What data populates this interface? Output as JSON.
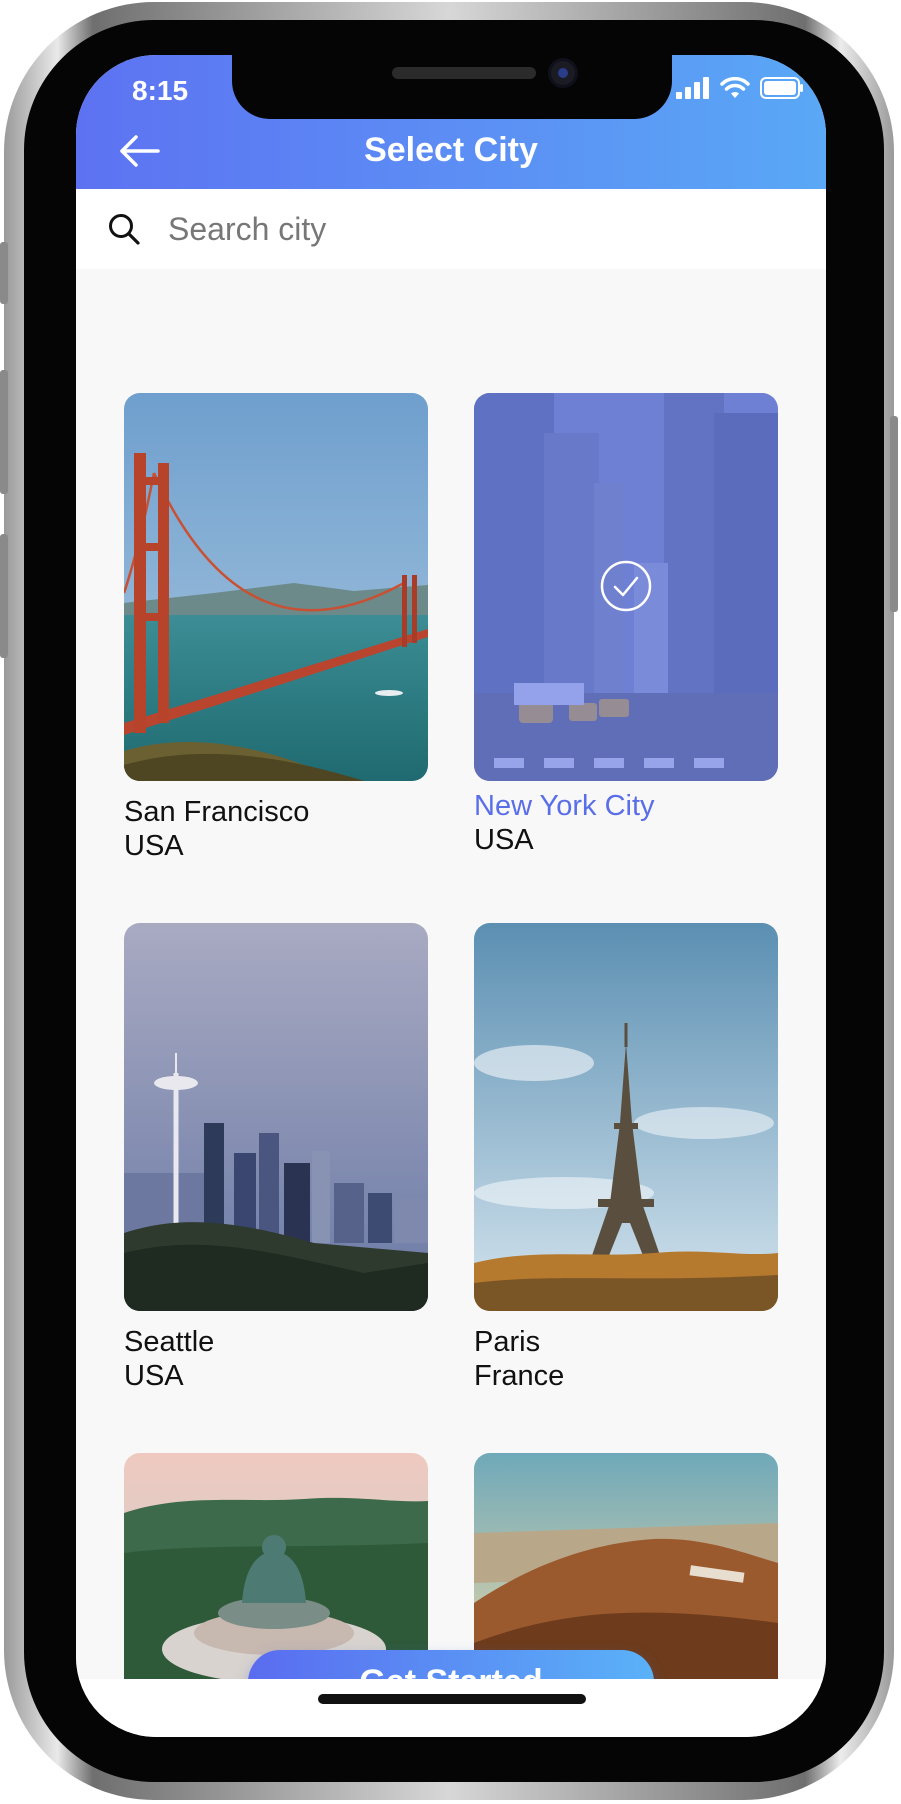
{
  "status_bar": {
    "time": "8:15"
  },
  "header": {
    "title": "Select City",
    "back_icon": "arrow-left-icon"
  },
  "search": {
    "placeholder": "Search city",
    "value": "",
    "icon": "search-icon"
  },
  "cities": [
    {
      "name": "San Francisco",
      "country": "USA",
      "selected": false
    },
    {
      "name": "New York City",
      "country": "USA",
      "selected": true
    },
    {
      "name": "Seattle",
      "country": "USA",
      "selected": false
    },
    {
      "name": "Paris",
      "country": "France",
      "selected": false
    },
    {
      "name": "",
      "country": "",
      "selected": false
    },
    {
      "name": "",
      "country": "",
      "selected": false
    }
  ],
  "cta": {
    "label": "Get Started"
  },
  "colors": {
    "accent": "#5a6ee8",
    "header_start": "#5d72f2",
    "header_end": "#5aa8f6"
  }
}
